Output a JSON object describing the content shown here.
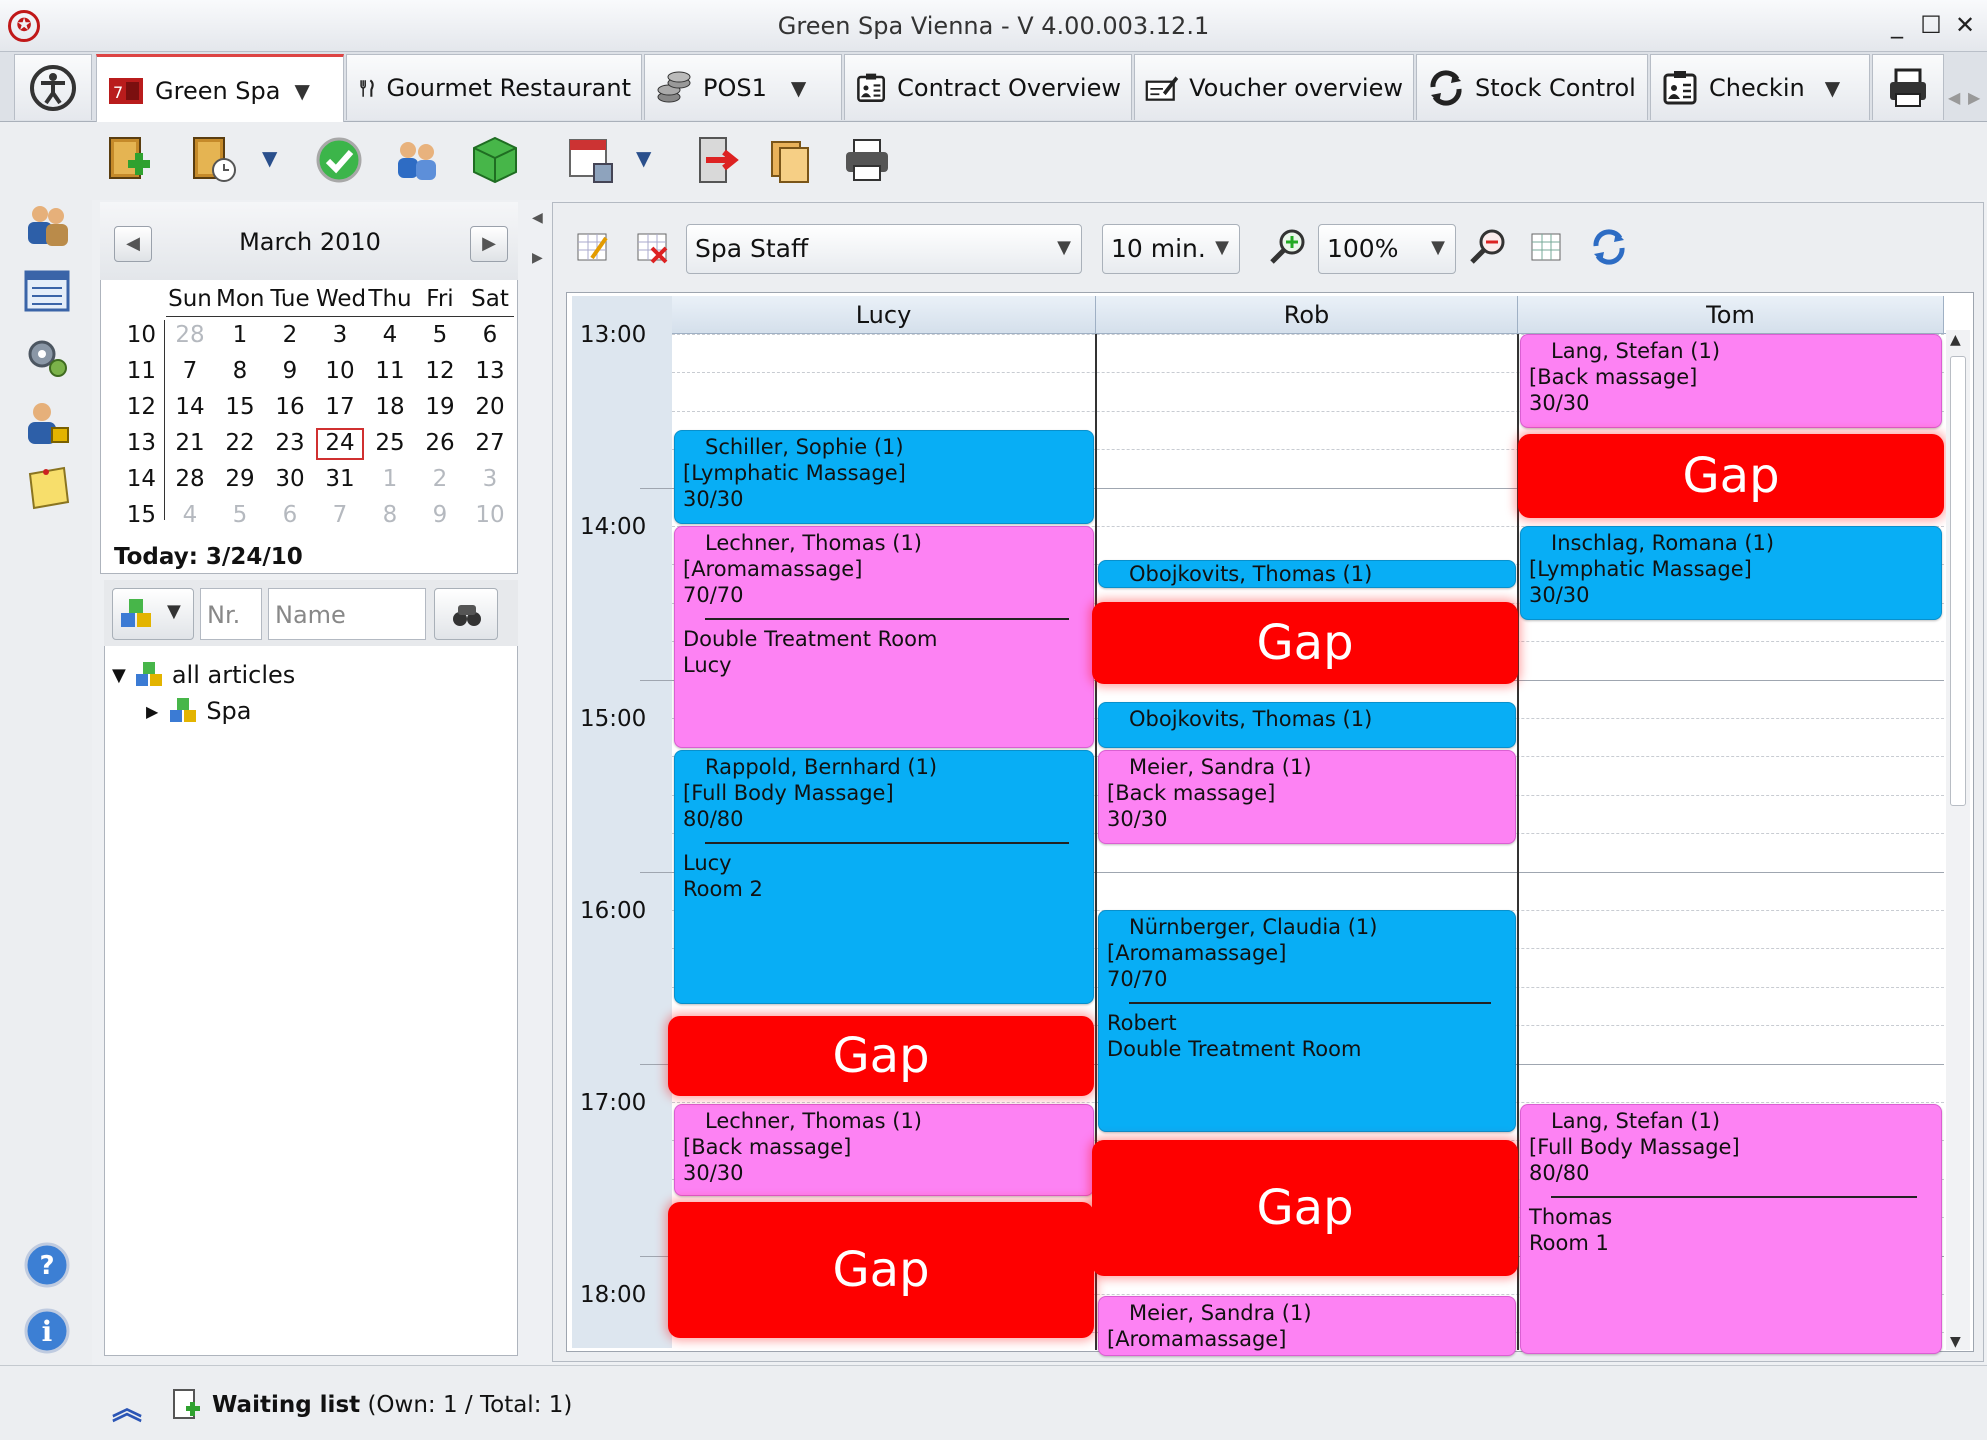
{
  "window": {
    "title": "Green Spa Vienna -  V 4.00.003.12.1",
    "minimize": "_",
    "maximize": "☐",
    "close": "✕"
  },
  "tabs": [
    {
      "label": "Green Spa",
      "dropdown": "▼"
    },
    {
      "label": "Gourmet Restaurant"
    },
    {
      "label": "POS1",
      "dropdown": "▼"
    },
    {
      "label": "Contract Overview"
    },
    {
      "label": "Voucher overview"
    },
    {
      "label": "Stock Control"
    },
    {
      "label": "Checkin",
      "dropdown": "▼"
    }
  ],
  "calendar": {
    "prev": "◀",
    "next": "▶",
    "month": "March 2010",
    "dow": [
      "Sun",
      "Mon",
      "Tue",
      "Wed",
      "Thu",
      "Fri",
      "Sat"
    ],
    "weeks": [
      {
        "no": "10",
        "days": [
          "28",
          "1",
          "2",
          "3",
          "4",
          "5",
          "6"
        ]
      },
      {
        "no": "11",
        "days": [
          "7",
          "8",
          "9",
          "10",
          "11",
          "12",
          "13"
        ]
      },
      {
        "no": "12",
        "days": [
          "14",
          "15",
          "16",
          "17",
          "18",
          "19",
          "20"
        ]
      },
      {
        "no": "13",
        "days": [
          "21",
          "22",
          "23",
          "24",
          "25",
          "26",
          "27"
        ]
      },
      {
        "no": "14",
        "days": [
          "28",
          "29",
          "30",
          "31",
          "1",
          "2",
          "3"
        ]
      },
      {
        "no": "15",
        "days": [
          "4",
          "5",
          "6",
          "7",
          "8",
          "9",
          "10"
        ]
      }
    ],
    "selected": "24",
    "today": "Today: 3/24/10"
  },
  "articles": {
    "nr_placeholder": "Nr.",
    "name_placeholder": "Name",
    "tree": [
      {
        "toggle": "▼",
        "label": "all articles"
      },
      {
        "toggle": "▶",
        "label": "Spa"
      }
    ]
  },
  "schedule": {
    "resource": "Spa Staff",
    "interval": "10 min.",
    "zoom": "100%",
    "staff": [
      "Lucy",
      "Rob",
      "Tom"
    ],
    "times": [
      "13:00",
      "14:00",
      "15:00",
      "16:00",
      "17:00",
      "18:00"
    ],
    "appointments": {
      "lucy_1": {
        "name": "Schiller, Sophie (1)",
        "treatment": "[Lymphatic Massage]",
        "duration": "30/30"
      },
      "lucy_2": {
        "name": "Lechner, Thomas (1)",
        "treatment": "[Aromamassage]",
        "duration": "70/70",
        "line1": "Double Treatment Room",
        "line2": "Lucy"
      },
      "lucy_3": {
        "name": "Rappold, Bernhard (1)",
        "treatment": "[Full Body Massage]",
        "duration": "80/80",
        "line1": "Lucy",
        "line2": "Room 2"
      },
      "lucy_4": {
        "name": "Lechner, Thomas (1)",
        "treatment": "[Back massage]",
        "duration": "30/30"
      },
      "rob_1": {
        "name": "Obojkovits, Thomas (1)"
      },
      "rob_2": {
        "name": "Obojkovits, Thomas (1)"
      },
      "rob_3": {
        "name": "Meier, Sandra (1)",
        "treatment": "[Back massage]",
        "duration": "30/30"
      },
      "rob_4": {
        "name": "Nürnberger, Claudia (1)",
        "treatment": "[Aromamassage]",
        "duration": "70/70",
        "line1": "Robert",
        "line2": "Double Treatment Room"
      },
      "rob_5": {
        "name": "Meier, Sandra (1)",
        "treatment": "[Aromamassage]"
      },
      "tom_1": {
        "name": "Lang, Stefan (1)",
        "treatment": "[Back massage]",
        "duration": "30/30"
      },
      "tom_2": {
        "name": "Inschlag, Romana (1)",
        "treatment": "[Lymphatic Massage]",
        "duration": "30/30"
      },
      "tom_3": {
        "name": "Lang, Stefan (1)",
        "treatment": "[Full Body Massage]",
        "duration": "80/80",
        "line1": "Thomas",
        "line2": "Room 1"
      }
    },
    "gap_label": "Gap",
    "colors": {
      "blue_appt": "#08aef5",
      "pink_appt": "#fd82f3",
      "gap": "#fe0000"
    }
  },
  "status": {
    "waiting_label": "Waiting list",
    "waiting_counts": "(Own: 1 / Total: 1)"
  }
}
